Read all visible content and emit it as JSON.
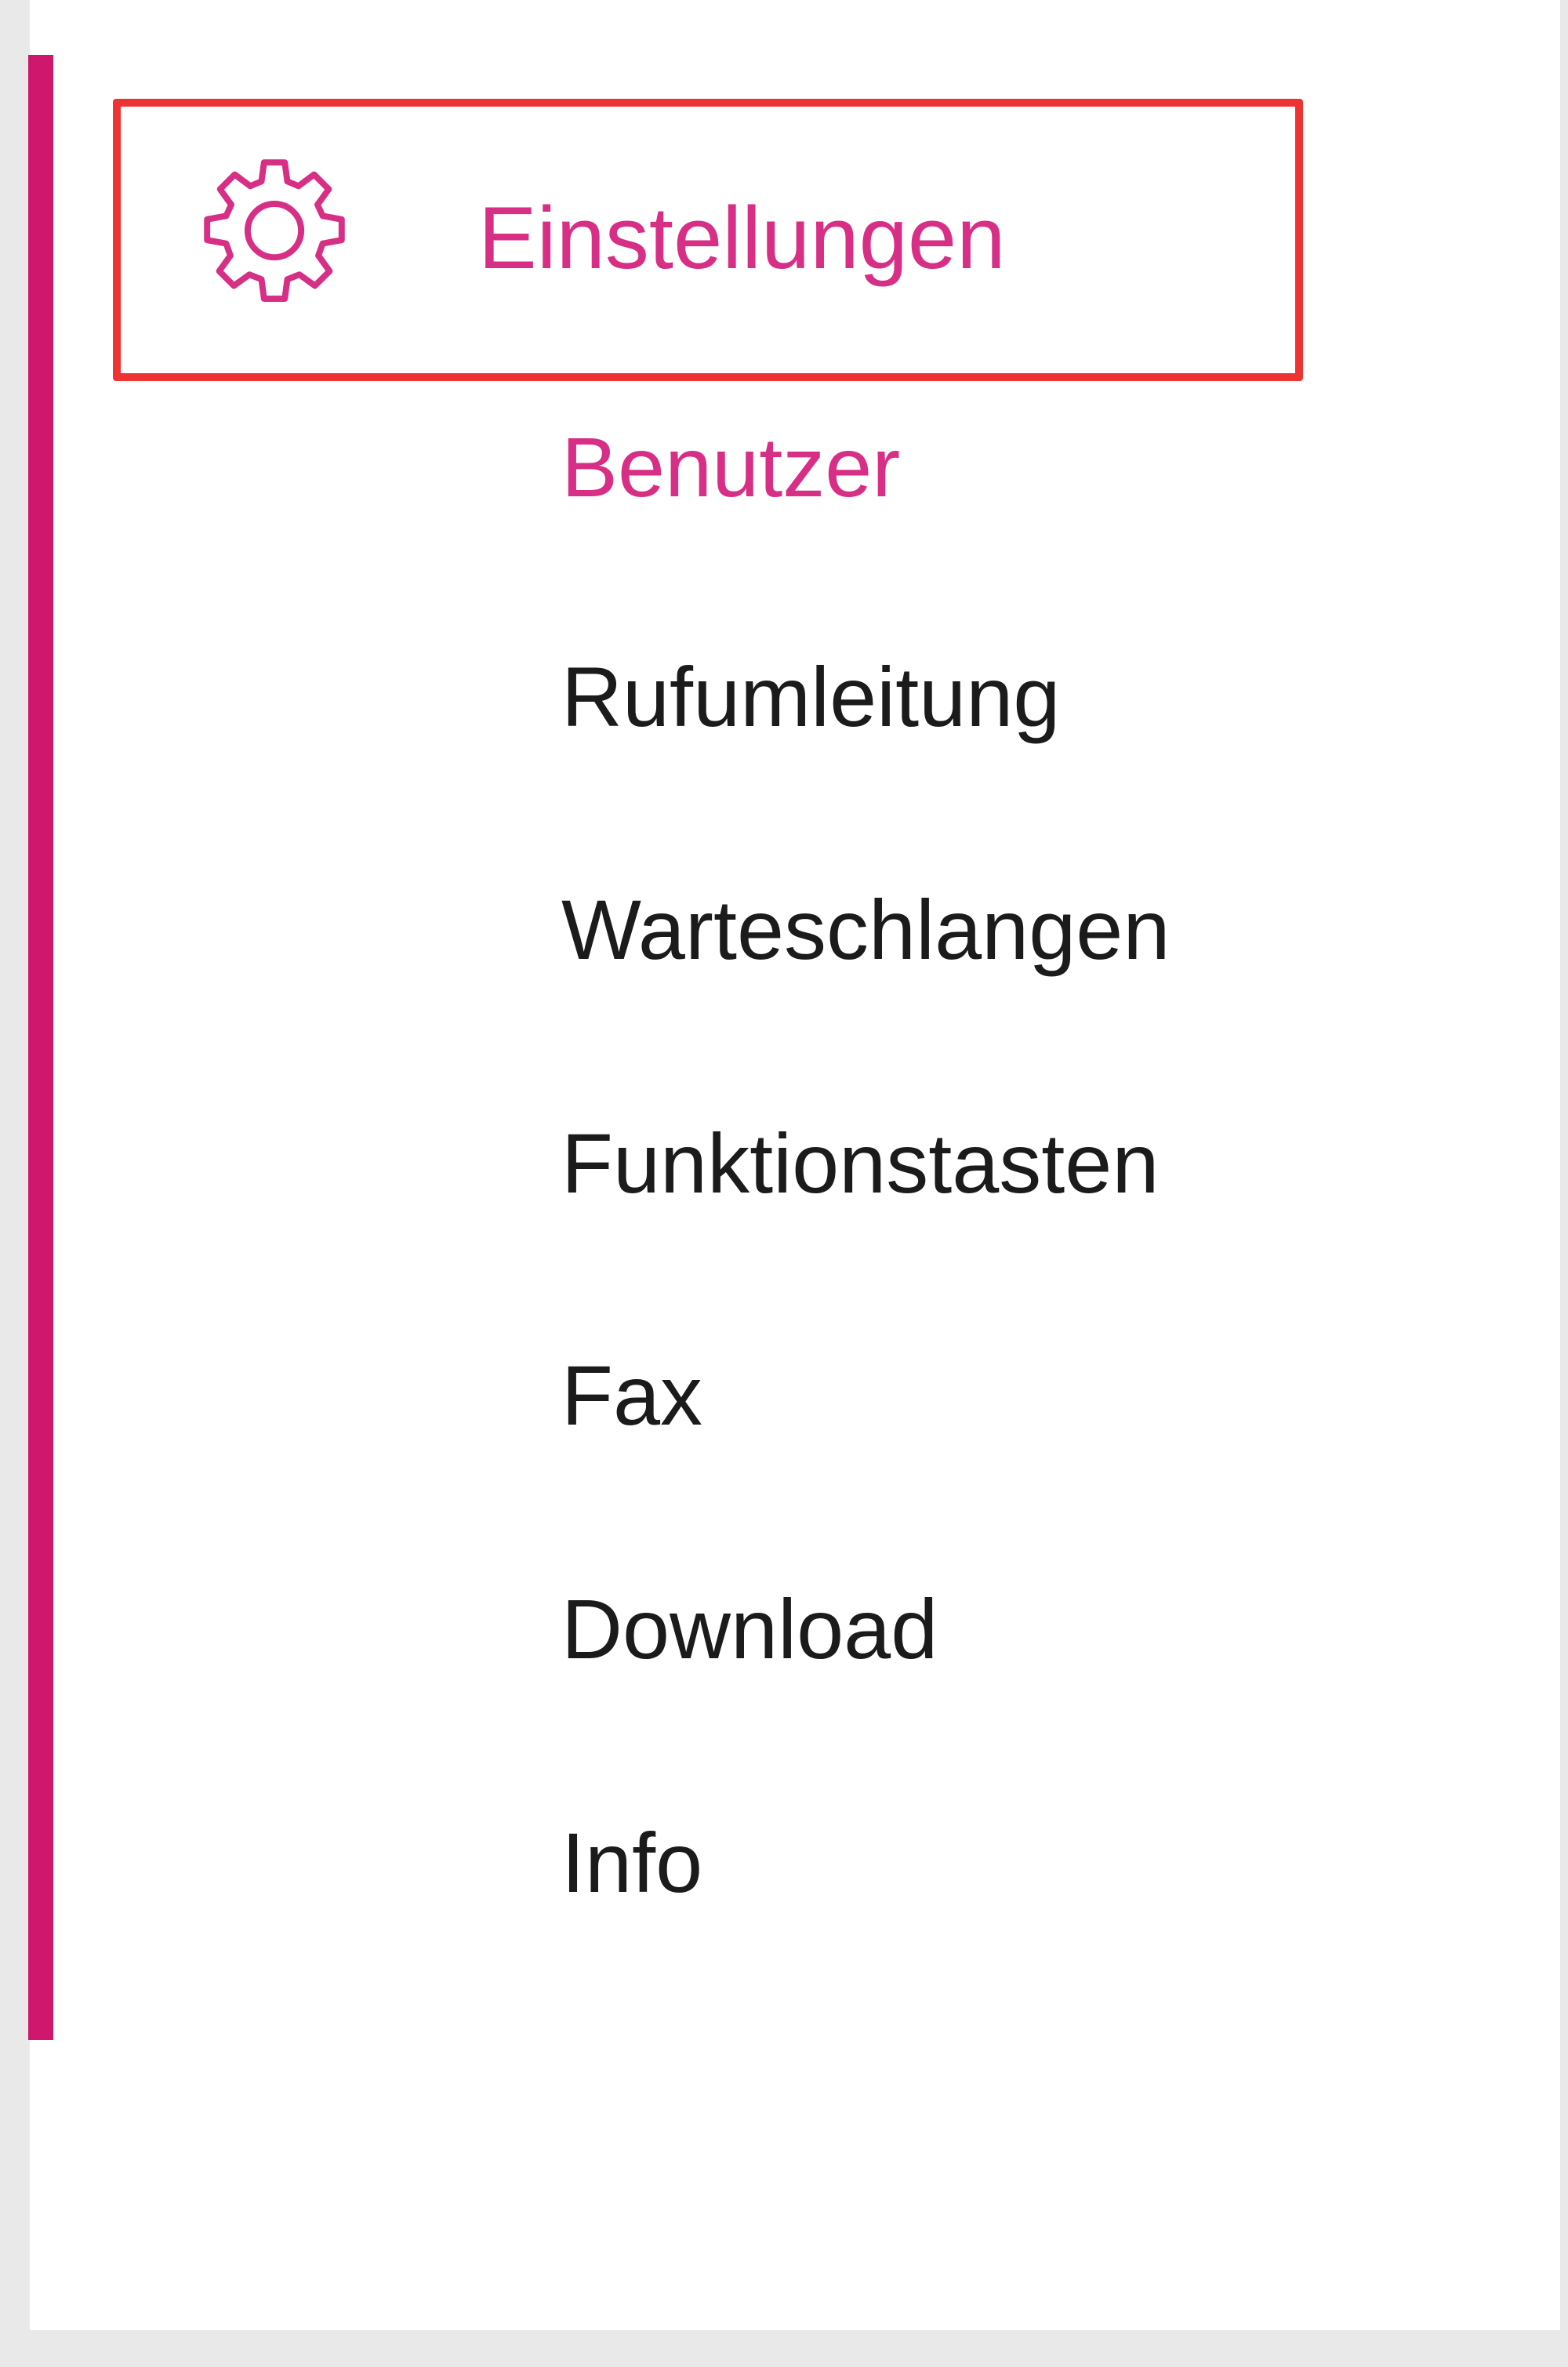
{
  "colors": {
    "accent": "#d72f86",
    "active_bar": "#d0176e",
    "highlight_border": "#ee3333",
    "text": "#1b1b1b"
  },
  "section": {
    "icon": "gear-icon",
    "label": "Einstellungen"
  },
  "menu": {
    "items": [
      {
        "label": "Benutzer",
        "selected": true
      },
      {
        "label": "Rufumleitung",
        "selected": false
      },
      {
        "label": "Warteschlangen",
        "selected": false
      },
      {
        "label": "Funktionstasten",
        "selected": false
      },
      {
        "label": "Fax",
        "selected": false
      },
      {
        "label": "Download",
        "selected": false
      },
      {
        "label": "Info",
        "selected": false
      }
    ]
  }
}
